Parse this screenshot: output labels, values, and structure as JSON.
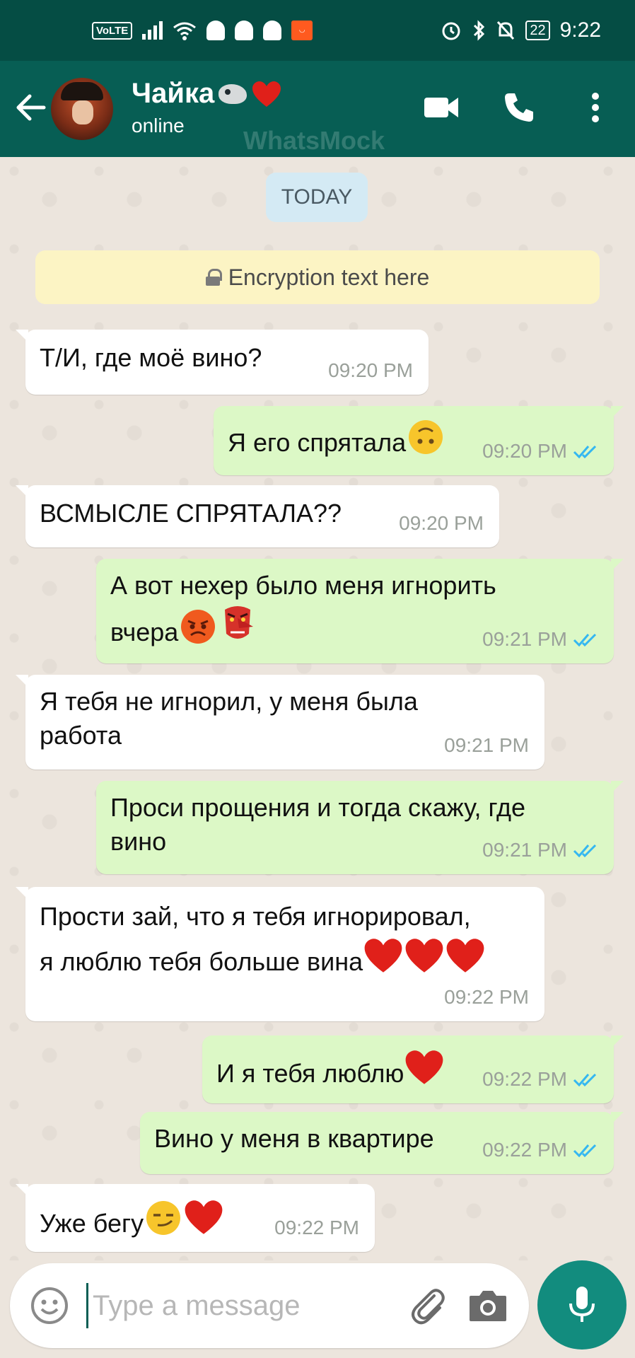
{
  "status_bar": {
    "volte": "VoLTE",
    "battery": "22",
    "time": "9:22",
    "icons": [
      "signal-icon",
      "wifi-icon",
      "snapchat-icon",
      "aliexpress-icon",
      "alarm-icon",
      "bluetooth-icon",
      "mute-icon",
      "battery-icon"
    ]
  },
  "header": {
    "contact_name": "Чайка",
    "status": "online",
    "watermark": "WhatsMock",
    "icons": [
      "back-arrow-icon",
      "video-call-icon",
      "phone-icon",
      "more-options-icon"
    ]
  },
  "chat": {
    "date_chip": "TODAY",
    "encryption_text": "Encryption text here",
    "messages": [
      {
        "dir": "in",
        "lines": [
          "Т/И, где моё вино?"
        ],
        "time": "09:20 PM"
      },
      {
        "dir": "out",
        "lines": [
          "Я его спрятала"
        ],
        "emoji": [
          "upside-down-face"
        ],
        "time": "09:20 PM",
        "read": true
      },
      {
        "dir": "in",
        "lines": [
          "ВСМЫСЛЕ СПРЯТАЛА??"
        ],
        "time": "09:20 PM"
      },
      {
        "dir": "out",
        "lines": [
          "А вот нехер было меня игнорить",
          "вчера"
        ],
        "emoji": [
          "angry-face",
          "goblin-mask"
        ],
        "time": "09:21 PM",
        "read": true
      },
      {
        "dir": "in",
        "lines": [
          "Я тебя не игнорил, у меня была",
          "работа"
        ],
        "time": "09:21 PM"
      },
      {
        "dir": "out",
        "lines": [
          "Проси прощения и тогда скажу, где",
          "вино"
        ],
        "time": "09:21 PM",
        "read": true
      },
      {
        "dir": "in",
        "lines": [
          "Прости зай, что я тебя игнорировал,",
          "я люблю тебя больше вина"
        ],
        "emoji": [
          "red-heart",
          "red-heart",
          "red-heart"
        ],
        "time": "09:22 PM"
      },
      {
        "dir": "out",
        "lines": [
          "И я тебя люблю"
        ],
        "emoji": [
          "red-heart"
        ],
        "time": "09:22 PM",
        "read": true
      },
      {
        "dir": "out",
        "lines": [
          "Вино у меня в квартире"
        ],
        "time": "09:22 PM",
        "read": true
      },
      {
        "dir": "in",
        "lines": [
          "Уже бегу"
        ],
        "emoji": [
          "smirking-face",
          "red-heart"
        ],
        "time": "09:22 PM"
      }
    ]
  },
  "input_bar": {
    "placeholder": "Type a message",
    "value": "",
    "icons": [
      "emoji-icon",
      "attach-icon",
      "camera-icon",
      "microphone-icon"
    ]
  },
  "colors": {
    "status_bar": "#054d44",
    "header": "#075e54",
    "outgoing_bubble": "#dcf8c6",
    "incoming_bubble": "#ffffff",
    "read_ticks": "#34b7f1",
    "mic_button": "#128c7e",
    "date_chip": "#d4eaf4",
    "encryption_banner": "#fcf4c4"
  }
}
